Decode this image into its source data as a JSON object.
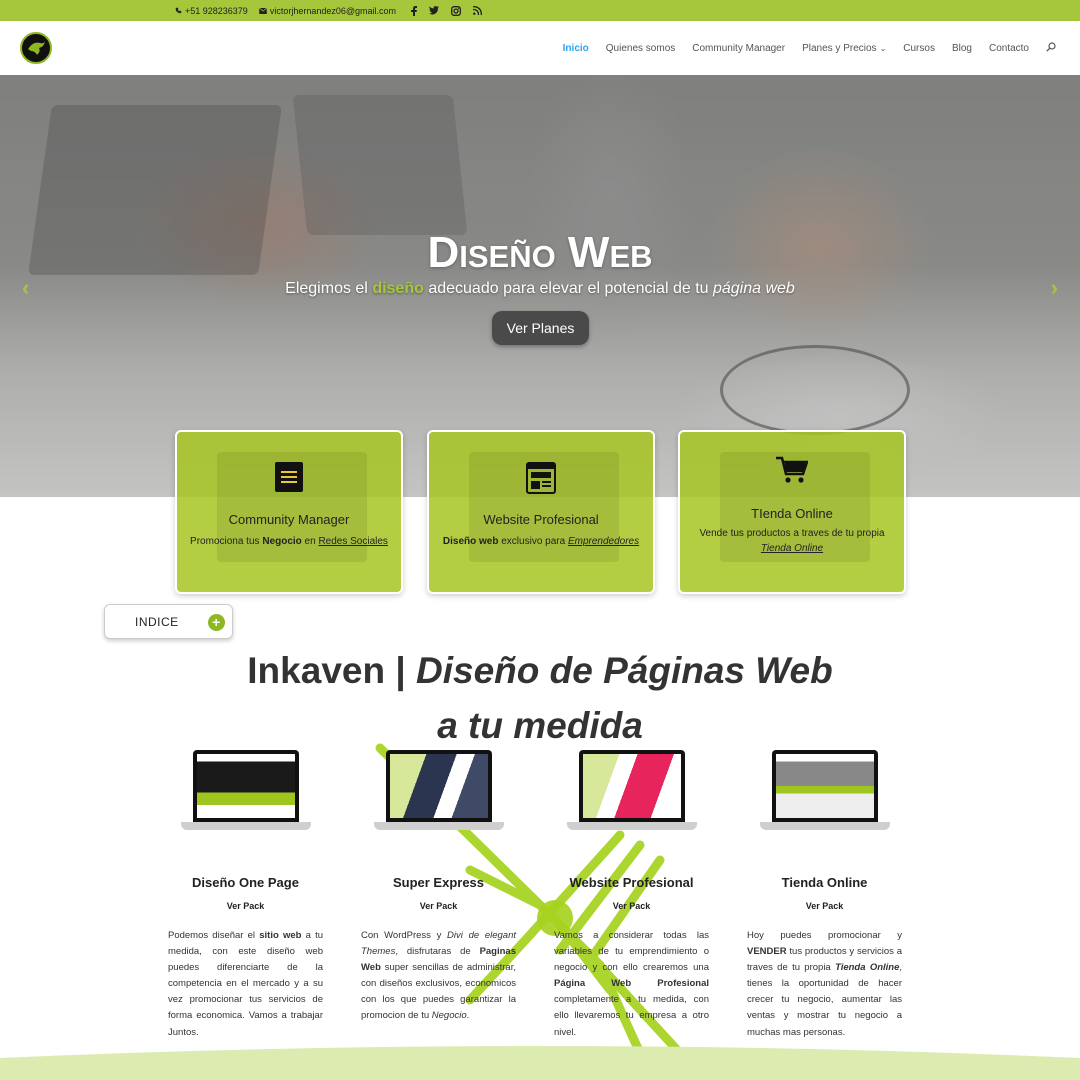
{
  "topbar": {
    "phone": "+51 928236379",
    "email": "victorjhernandez06@gmail.com",
    "social": [
      "facebook-icon",
      "twitter-icon",
      "instagram-icon",
      "rss-icon"
    ]
  },
  "nav": {
    "items": [
      {
        "label": "Inicio"
      },
      {
        "label": "Quienes somos"
      },
      {
        "label": "Community Manager"
      },
      {
        "label": "Planes y Precios"
      },
      {
        "label": "Cursos"
      },
      {
        "label": "Blog"
      },
      {
        "label": "Contacto"
      }
    ]
  },
  "hero": {
    "title": "Diseño Web",
    "subtitle_part1": "Elegimos el",
    "subtitle_highlight": "diseño",
    "subtitle_part2": "adecuado para elevar el potencial de tu",
    "subtitle_em": "página web",
    "button": "Ver Planes"
  },
  "cards": [
    {
      "title": "Community Manager",
      "d1": "Promociona tus",
      "d2": "Negocio",
      "d3": "en",
      "d4": "Redes Sociales"
    },
    {
      "title": "Website Profesional",
      "d1": "Diseño web",
      "d2": "exclusivo para",
      "d3": "Emprendedores"
    },
    {
      "title": "TIenda Online",
      "d1": "Vende tus productos a traves de tu propia",
      "d2": "Tienda Online"
    }
  ],
  "indice": {
    "label": "INDICE"
  },
  "heading": {
    "line1a": "Inkaven | ",
    "line1b": "Diseño de Páginas Web",
    "line2": "a tu medida"
  },
  "products": [
    {
      "title": "Diseño One Page",
      "pack": "Ver Pack"
    },
    {
      "title": "Super Express",
      "pack": "Ver Pack"
    },
    {
      "title": "Website Profesional",
      "pack": "Ver Pack"
    },
    {
      "title": "Tienda Online",
      "pack": "Ver Pack"
    }
  ],
  "p1": {
    "a": "Podemos diseñar el",
    "b": "sitio web",
    "c": "a tu medida, con este diseño web puedes diferenciarte de la competencia en el mercado y a su vez promocionar tus servicios de forma economica. Vamos a trabajar Juntos."
  },
  "p2": {
    "a": "Con WordPress y",
    "b": "Divi de elegant Themes",
    "c": ", disfrutaras de",
    "d": "Paginas Web",
    "e": "super sencillas de administrar, con diseños exclusivos, economicos con los que puedes garantizar la promocion de tu",
    "f": "Negocio",
    "g": "."
  },
  "p3": {
    "a": "Vamos a considerar todas las variables de tu emprendimiento o negocio y con ello crearemos una",
    "b": "Página Web Profesional",
    "c": "completamente a tu medida, con ello llevaremos tu empresa a otro nivel."
  },
  "p4": {
    "a": "Hoy puedes promocionar y",
    "b": "VENDER",
    "c": "tus productos y servicios a traves de tu propia",
    "d": "Tienda Online",
    "e": ", tienes la oportunidad de hacer crecer tu negocio, aumentar las ventas y mostrar tu negocio a muchas mas personas."
  },
  "colors": {
    "accent": "#a6c63b",
    "active_link": "#2ea3f2",
    "button": "#4a4a4a"
  }
}
